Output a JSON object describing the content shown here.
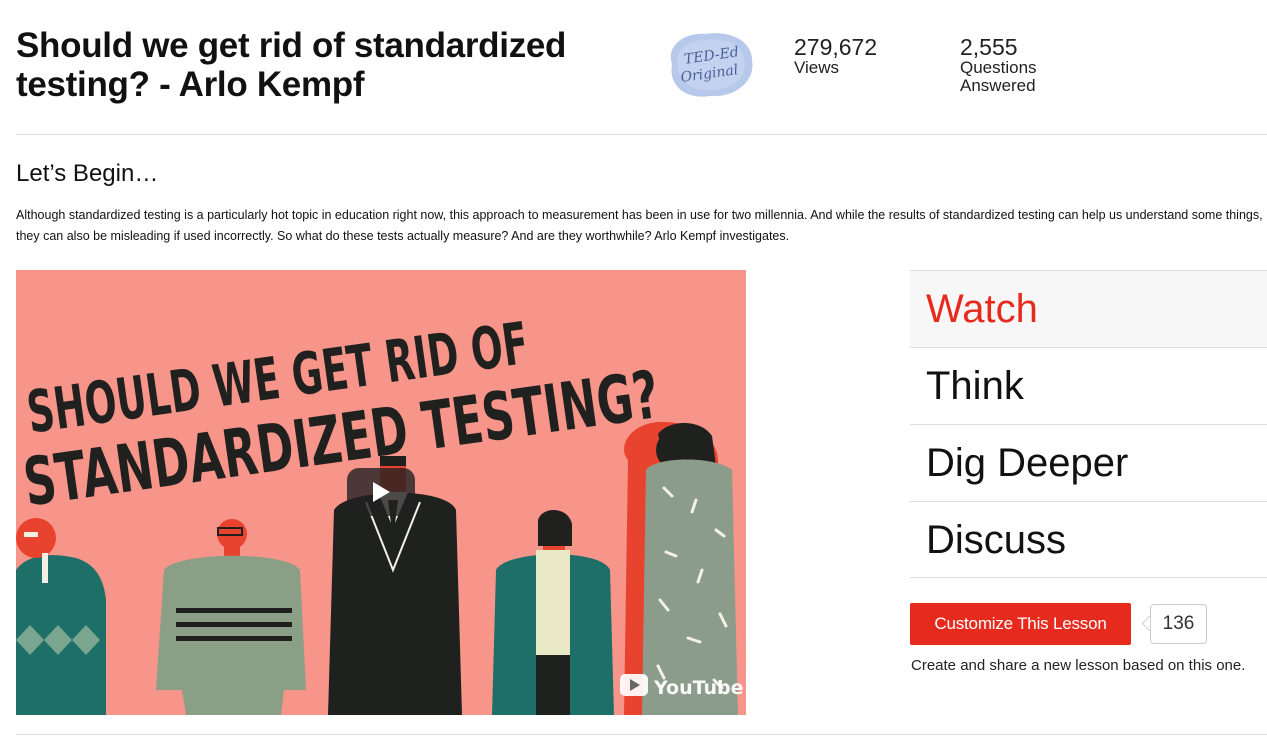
{
  "lesson": {
    "title": "Should we get rid of standardized testing? - Arlo Kempf",
    "badge_line1": "TED-Ed",
    "badge_line2": "Original",
    "views_count": "279,672",
    "views_label": "Views",
    "answered_count": "2,555",
    "answered_label_1": "Questions",
    "answered_label_2": "Answered"
  },
  "intro": {
    "heading": "Let’s Begin…",
    "description": "Although standardized testing is a particularly hot topic in education right now, this approach to measurement has been in use for two millennia. And while the results of standardized testing can help us understand some things, they can also be misleading if used incorrectly. So what do these tests actually measure? And are they worthwhile? Arlo Kempf investigates."
  },
  "video": {
    "headline_line1": "SHOULD WE GET RID OF",
    "headline_line2": "STANDARDIZED TESTING?",
    "youtube_label": "YouTube",
    "background_color": "#f7958a"
  },
  "tabs": [
    {
      "label": "Watch",
      "active": true
    },
    {
      "label": "Think",
      "active": false
    },
    {
      "label": "Dig Deeper",
      "active": false
    },
    {
      "label": "Discuss",
      "active": false
    }
  ],
  "customize": {
    "button_label": "Customize This Lesson",
    "count": "136",
    "note": "Create and share a new lesson based on this one."
  },
  "colors": {
    "accent": "#e62b1e",
    "tab_active_bg": "#f7f7f7",
    "divider": "#dddddd"
  }
}
